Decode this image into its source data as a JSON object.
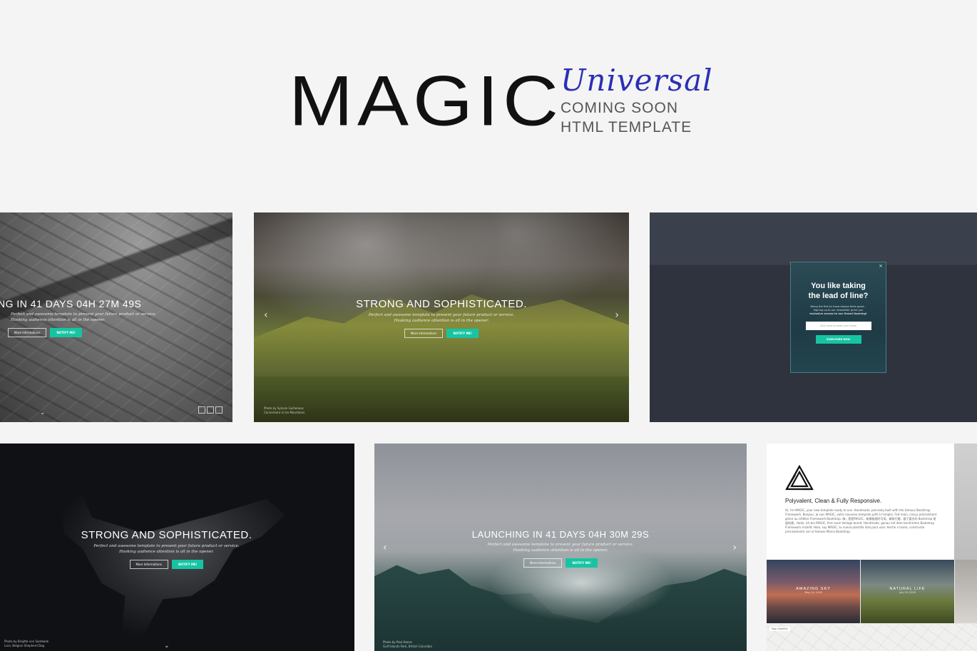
{
  "header": {
    "brand": "MAGIC",
    "script_word": "Universal",
    "tagline_line1": "COMING SOON",
    "tagline_line2": "HTML TEMPLATE"
  },
  "cards": {
    "card1": {
      "headline": "NG IN 41 DAYS 04H 27M 49S",
      "sub1": "Perfect and awesome template to present your future product or service.",
      "sub2": "Hooking audience attention is all in the opener.",
      "btn_more": "More Informations",
      "btn_notify": "NOTIFY ME!"
    },
    "card2": {
      "headline": "STRONG AND SOPHISTICATED.",
      "sub1": "Perfect and awesome template to present your future product or service.",
      "sub2": "Hooking audience attention is all in the opener.",
      "btn_more": "More Informations",
      "btn_notify": "NOTIFY ME!",
      "arrow_left": "‹",
      "arrow_right": "›",
      "credit1": "Photo by Sylvain Guiheneuc",
      "credit2": "Connemara in Ice Mountains"
    },
    "card3": {
      "close": "×",
      "popup_title_1": "You like taking",
      "popup_title_2": "the lead of line?",
      "popup_body_1": "Being the first to know always feels great...",
      "popup_body_2": "Signing up to our newsletter gives you",
      "popup_body_3": "exclusive access to our Grand Opening!",
      "email_placeholder": "Click here to write your email",
      "subscribe": "SUBSCRIBE NOW"
    },
    "card4": {
      "headline": "STRONG AND SOPHISTICATED.",
      "sub1": "Perfect and awesome template to present your future product or service.",
      "sub2": "Hooking audience attention is all in the opener.",
      "btn_more": "More Informations",
      "btn_notify": "NOTIFY ME!",
      "credit1": "Photo by Brigitte von Sambeek",
      "credit2": "Lara, Belgian Shepherd Dog"
    },
    "card5": {
      "headline": "LAUNCHING IN 41 DAYS 04H 30M 29S",
      "sub1": "Perfect and awesome template to present your future product or service.",
      "sub2": "Hooking audience attention is all in the opener.",
      "btn_more": "More Informations",
      "btn_notify": "NOTIFY ME!",
      "arrow_left": "‹",
      "arrow_right": "›",
      "credit1": "Photo by Paul Hanes",
      "credit2": "Gulf Islands Park, British Columbia"
    },
    "card6": {
      "title": "Polyvalent, Clean & Fully Responsive.",
      "body": "Hi, I'm MAGIC, your new template ready to use. Handmade, precisely built with the famous Bootstrap Framework. Bonjour, je suis MAGIC, votre nouveau template prêt à l'emploi. Fait main, conçu précisément grâce au célèbre Framework Bootstrap. 嗨，我是MAGIC，新模板随时可用。精致打磨，基于著名的 Bootstrap 框架构建。Hallo, ich bin MAGIC, Ihre neue Vorlage bereit. Handmade, genau mit dem berühmten Bootstrap Framework erstellt. Hola, soy MAGIC, tu nueva plantilla lista para usar. Hecho a mano, construido precisamente con el famoso Marco Bootstrap.",
      "tile1_title": "AMAZING SKY",
      "tile1_date": "May 14, 2016",
      "tile2_title": "NATURAL LIFE",
      "tile2_date": "July 29, 2016",
      "map_tab": "Map  Satellite"
    }
  }
}
